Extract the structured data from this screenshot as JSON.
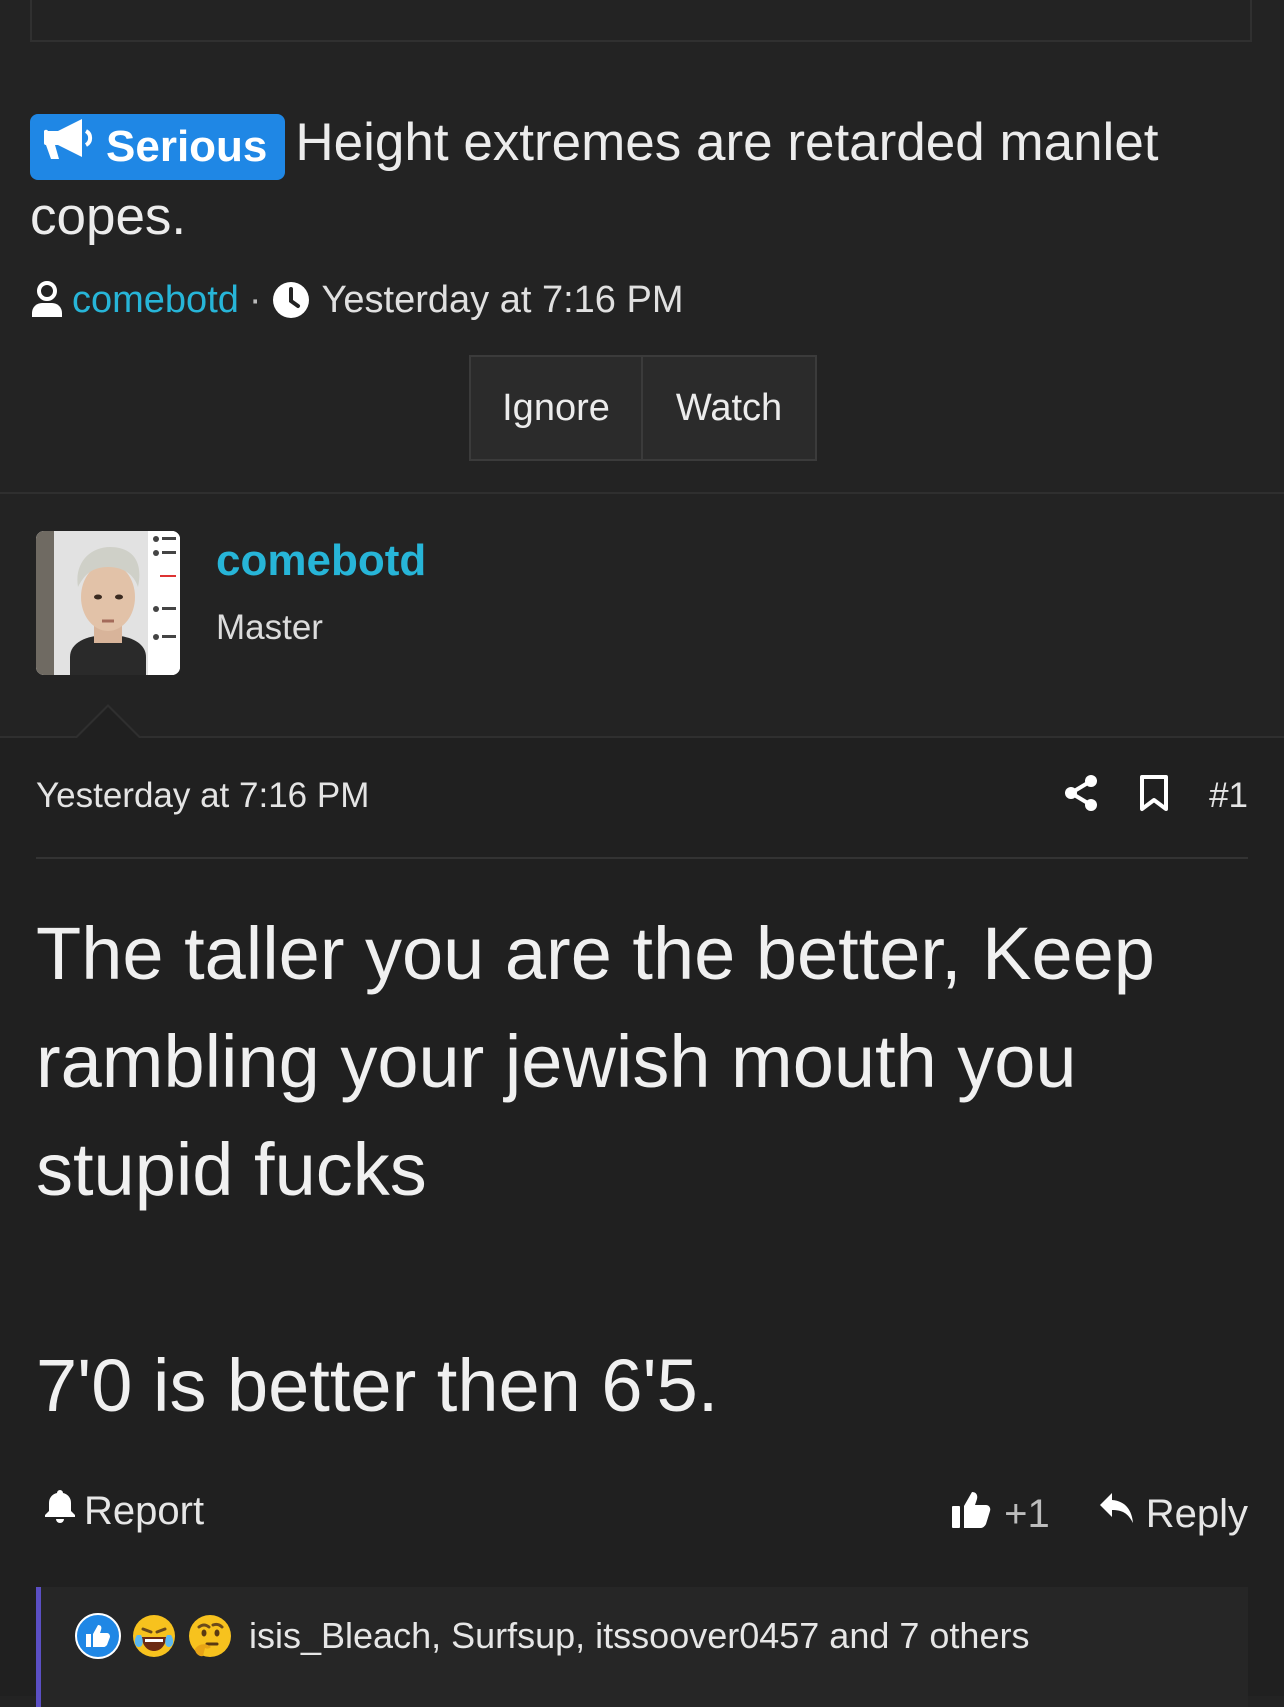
{
  "thread": {
    "prefix": "Serious",
    "prefix_color": "#1f87e5",
    "title": "Height extremes are retarded manlet copes.",
    "author": "comebotd",
    "separator": "·",
    "timestamp": "Yesterday at 7:16 PM"
  },
  "buttons": {
    "ignore": "Ignore",
    "watch": "Watch"
  },
  "poster": {
    "username": "comebotd",
    "user_title": "Master",
    "accent_color": "#27b5d8"
  },
  "post": {
    "date": "Yesterday at 7:16 PM",
    "number": "#1",
    "body_line1": "The taller you are the better, Keep rambling your jewish mouth you stupid fucks",
    "body_line2": "7'0 is better then 6'5.",
    "report_label": "Report",
    "like_count": "+1",
    "reply_label": "Reply"
  },
  "reactions": {
    "icons": [
      "like-icon",
      "laugh-cry-icon",
      "thinking-icon"
    ],
    "summary": "isis_Bleach, Surfsup, itssoover0457 and 7 others"
  }
}
